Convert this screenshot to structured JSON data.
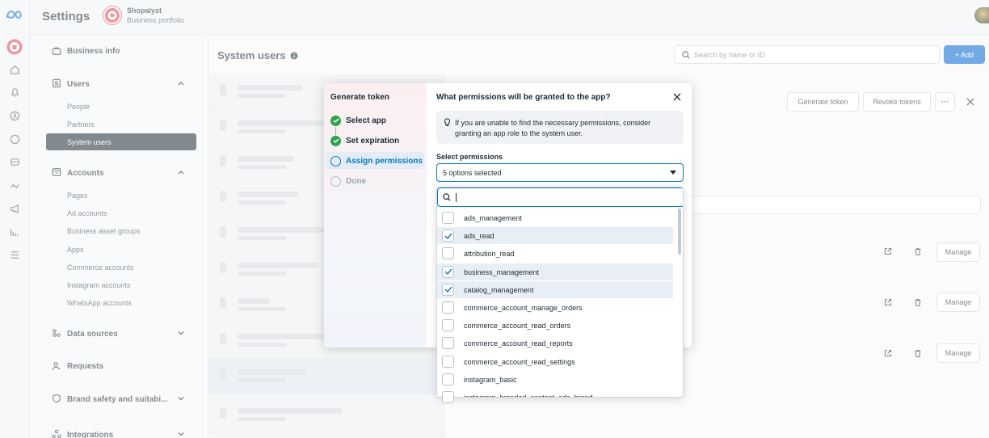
{
  "app": {
    "title": "Settings",
    "business_name": "Shopalyst",
    "business_sub": "Business portfolio"
  },
  "colors": {
    "accent": "#0a78be",
    "primary_button": "#0064d1",
    "success": "#31a24c"
  },
  "nav": {
    "business_info": "Business info",
    "users": {
      "label": "Users",
      "items": [
        "People",
        "Partners",
        "System users"
      ],
      "selected": "System users"
    },
    "accounts": {
      "label": "Accounts",
      "items": [
        "Pages",
        "Ad accounts",
        "Business asset groups",
        "Apps",
        "Commerce accounts",
        "Instagram accounts",
        "WhatsApp accounts"
      ]
    },
    "data_sources": "Data sources",
    "requests": "Requests",
    "brand_safety": "Brand safety and suitabi...",
    "integrations": "Integrations"
  },
  "page": {
    "title": "System users",
    "search_placeholder": "Search by name or ID",
    "add_label": "+ Add",
    "generate_token": "Generate token",
    "revoke_tokens": "Revoke tokens",
    "more_label": "···",
    "manage_label": "Manage"
  },
  "dialog": {
    "left_title": "Generate token",
    "steps": [
      {
        "label": "Select app",
        "state": "done"
      },
      {
        "label": "Set expiration",
        "state": "done"
      },
      {
        "label": "Assign permissions",
        "state": "current"
      },
      {
        "label": "Done",
        "state": "pending"
      }
    ],
    "title": "What permissions will be granted to the app?",
    "info_text_1": "If you are unable to find the necessary permissions, consider",
    "info_text_2": "granting an app role to the system user.",
    "select_label": "Select permissions",
    "selected_summary": "5 options selected",
    "search_value": "",
    "options": [
      {
        "label": "ads_management",
        "checked": false
      },
      {
        "label": "ads_read",
        "checked": true
      },
      {
        "label": "attribution_read",
        "checked": false
      },
      {
        "label": "business_management",
        "checked": true
      },
      {
        "label": "catalog_management",
        "checked": true
      },
      {
        "label": "commerce_account_manage_orders",
        "checked": false
      },
      {
        "label": "commerce_account_read_orders",
        "checked": false
      },
      {
        "label": "commerce_account_read_reports",
        "checked": false
      },
      {
        "label": "commerce_account_read_settings",
        "checked": false
      },
      {
        "label": "instagram_basic",
        "checked": false
      },
      {
        "label": "instagram_branded_content_ads_brand",
        "checked": false
      }
    ]
  }
}
